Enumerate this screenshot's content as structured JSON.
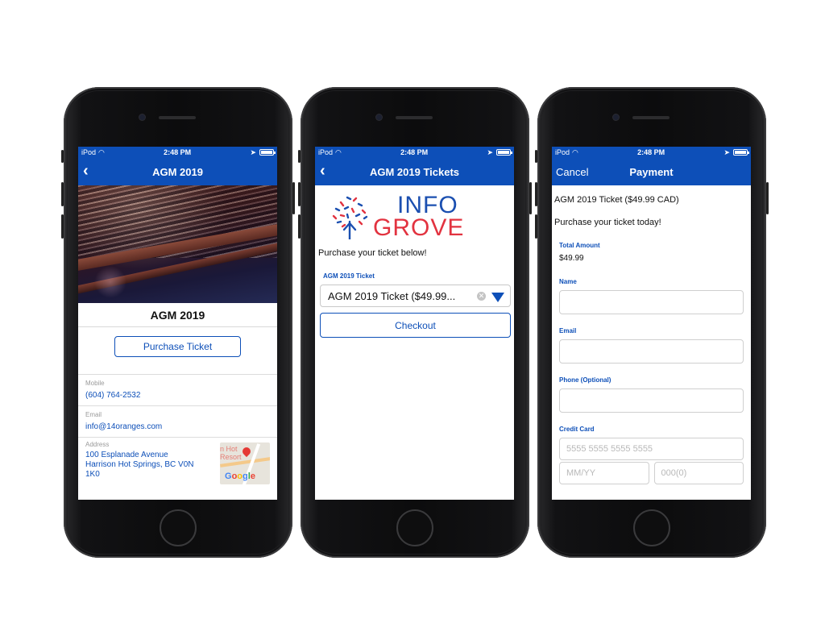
{
  "status_bar": {
    "carrier": "iPod",
    "time": "2:48 PM"
  },
  "screen1": {
    "nav_title": "AGM 2019",
    "event_title": "AGM 2019",
    "purchase_button": "Purchase Ticket",
    "mobile_label": "Mobile",
    "mobile_value": "(604) 764-2532",
    "email_label": "Email",
    "email_value": "info@14oranges.com",
    "address_label": "Address",
    "address_lines": [
      "100 Esplanade Avenue",
      "Harrison Hot Springs, BC V0N",
      "1K0"
    ],
    "map_text": [
      "n Hot",
      "Resort"
    ],
    "map_brand": "Google"
  },
  "screen2": {
    "nav_title": "AGM 2019 Tickets",
    "logo_word1": "INFO",
    "logo_word2": "GROVE",
    "intro_text": "Purchase your ticket below!",
    "ticket_label": "AGM 2019 Ticket",
    "ticket_selected": "AGM 2019 Ticket ($49.99...",
    "checkout_button": "Checkout"
  },
  "screen3": {
    "nav_cancel": "Cancel",
    "nav_title": "Payment",
    "ticket_line": "AGM 2019 Ticket ($49.99 CAD)",
    "tagline": "Purchase your ticket today!",
    "total_label": "Total Amount",
    "total_value": "$49.99",
    "name_label": "Name",
    "name_value": "",
    "email_label": "Email",
    "email_value": "",
    "phone_label": "Phone (Optional)",
    "phone_value": "",
    "card_label": "Credit Card",
    "card_placeholder": "5555 5555 5555 5555",
    "expiry_placeholder": "MM/YY",
    "cvc_placeholder": "000(0)"
  },
  "colors": {
    "brand_blue": "#0d4fb8",
    "logo_red": "#e23340"
  }
}
